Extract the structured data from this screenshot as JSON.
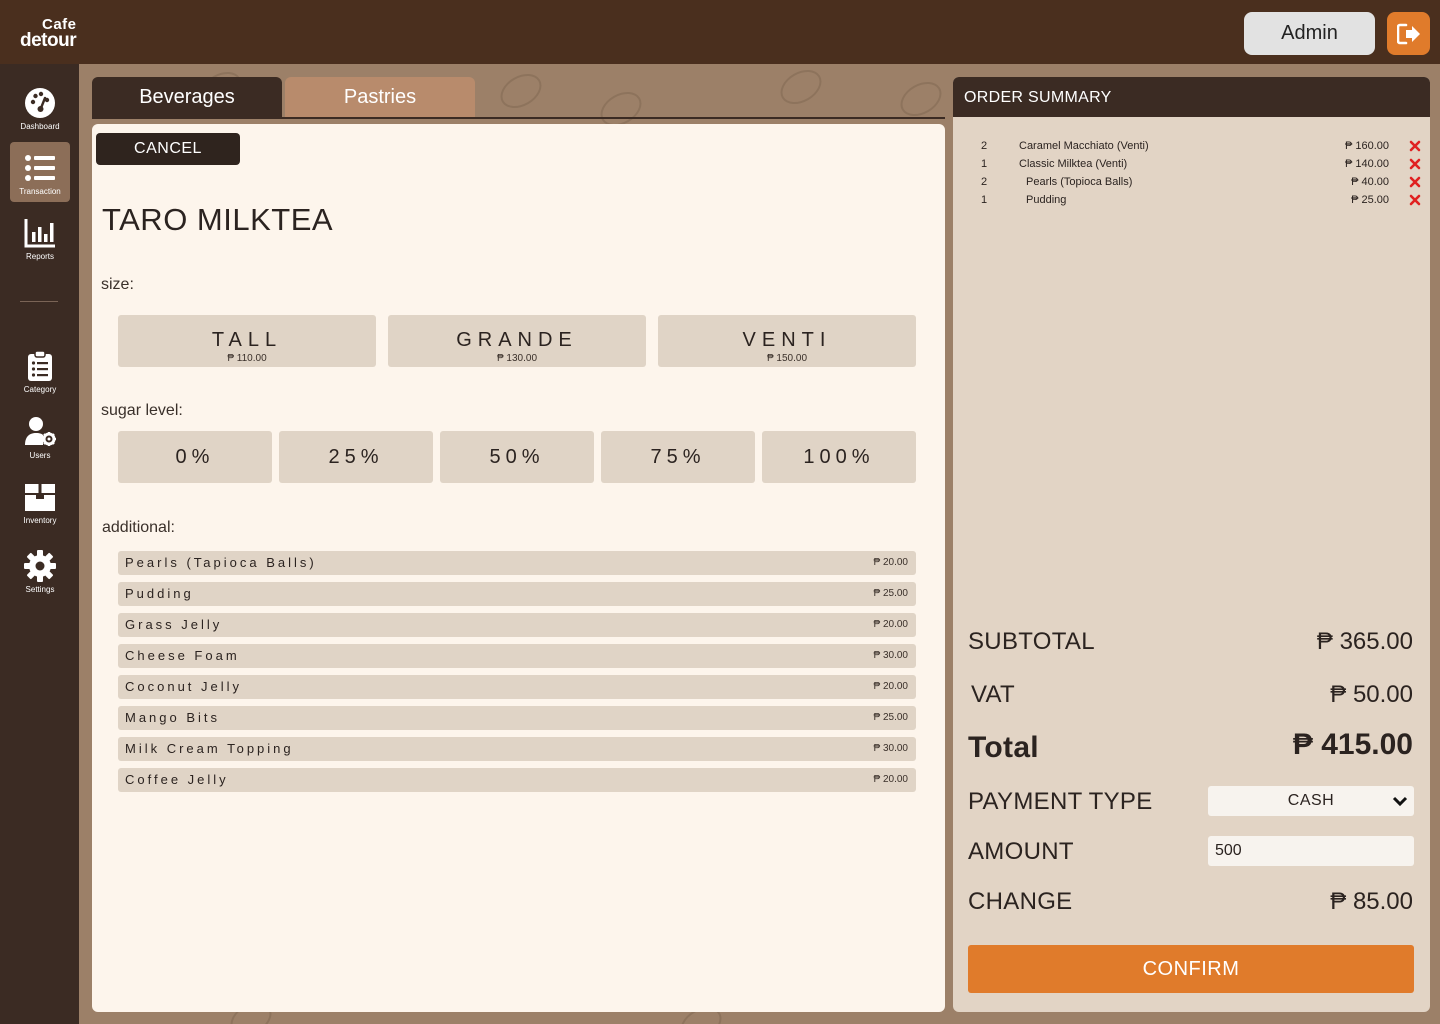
{
  "brand": {
    "line1": "Cafe",
    "line2": "detour"
  },
  "header": {
    "admin_label": "Admin",
    "logout_icon": "logout-icon"
  },
  "sidebar": {
    "items": [
      {
        "label": "Dashboard",
        "icon": "dashboard-icon"
      },
      {
        "label": "Transaction",
        "icon": "list-icon",
        "active": true
      },
      {
        "label": "Reports",
        "icon": "bar-chart-icon"
      },
      {
        "label": "Category",
        "icon": "clipboard-icon"
      },
      {
        "label": "Users",
        "icon": "user-gear-icon"
      },
      {
        "label": "Inventory",
        "icon": "box-icon"
      },
      {
        "label": "Settings",
        "icon": "gear-icon"
      }
    ]
  },
  "tabs": [
    {
      "label": "Beverages",
      "active": true
    },
    {
      "label": "Pastries",
      "active": false
    }
  ],
  "product": {
    "cancel_label": "CANCEL",
    "name": "TARO MILKTEA",
    "size_label": "size:",
    "sizes": [
      {
        "name": "TALL",
        "price": "₱ 110.00"
      },
      {
        "name": "GRANDE",
        "price": "₱ 130.00"
      },
      {
        "name": "VENTI",
        "price": "₱ 150.00"
      }
    ],
    "sugar_label": "sugar level:",
    "sugar_levels": [
      "0%",
      "25%",
      "50%",
      "75%",
      "100%"
    ],
    "additional_label": "additional:",
    "addons": [
      {
        "name": "Pearls (Tapioca Balls)",
        "price": "₱ 20.00"
      },
      {
        "name": "Pudding",
        "price": "₱ 25.00"
      },
      {
        "name": "Grass Jelly",
        "price": "₱ 20.00"
      },
      {
        "name": "Cheese Foam",
        "price": "₱ 30.00"
      },
      {
        "name": "Coconut Jelly",
        "price": "₱ 20.00"
      },
      {
        "name": "Mango Bits",
        "price": "₱ 25.00"
      },
      {
        "name": "Milk Cream Topping",
        "price": "₱ 30.00"
      },
      {
        "name": "Coffee Jelly",
        "price": "₱ 20.00"
      }
    ]
  },
  "summary": {
    "title": "ORDER SUMMARY",
    "lines": [
      {
        "qty": "2",
        "name": "Caramel Macchiato (Venti)",
        "price": "₱ 160.00"
      },
      {
        "qty": "1",
        "name": "Classic Milktea (Venti)",
        "price": "₱ 140.00"
      },
      {
        "qty": "2",
        "name": "Pearls (Topioca Balls)",
        "price": "₱ 40.00"
      },
      {
        "qty": "1",
        "name": "Pudding",
        "price": "₱ 25.00"
      }
    ],
    "subtotal_label": "SUBTOTAL",
    "subtotal_value": "₱ 365.00",
    "vat_label": "VAT",
    "vat_value": "₱ 50.00",
    "total_label": "Total",
    "total_value": "₱ 415.00",
    "payment_label": "PAYMENT TYPE",
    "payment_value": "CASH",
    "amount_label": "AMOUNT",
    "amount_value": "500",
    "change_label": "CHANGE",
    "change_value": "₱ 85.00",
    "confirm_label": "CONFIRM",
    "remove_color": "#e02020",
    "accent_color": "#e07b2b"
  }
}
